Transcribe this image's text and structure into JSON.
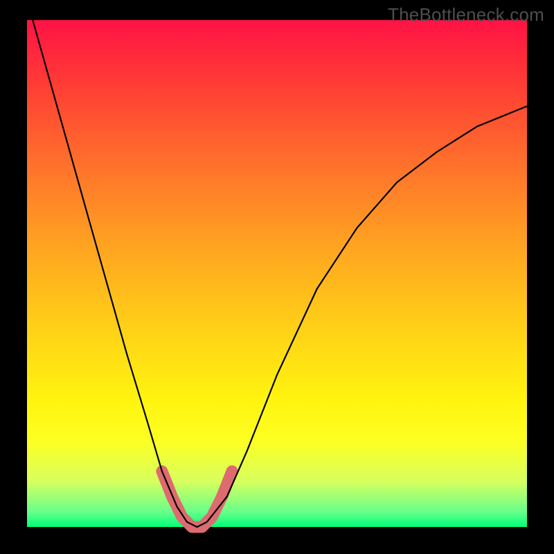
{
  "watermark": "TheBottleneck.com",
  "chart_data": {
    "type": "line",
    "title": "",
    "xlabel": "",
    "ylabel": "",
    "xlim": [
      0,
      100
    ],
    "ylim": [
      0,
      100
    ],
    "grid": false,
    "legend": false,
    "background_gradient": {
      "top": "#ff1245",
      "mid": "#ffd416",
      "bottom": "#00ff78"
    },
    "series": [
      {
        "name": "bottleneck-curve",
        "color": "#000000",
        "x": [
          0,
          4,
          8,
          12,
          16,
          20,
          24,
          27,
          30,
          32,
          34,
          36,
          40,
          44,
          50,
          58,
          66,
          74,
          82,
          90,
          100
        ],
        "y": [
          104,
          90,
          76,
          62,
          48,
          34,
          21,
          11,
          4,
          1,
          0,
          1,
          6,
          15,
          30,
          47,
          59,
          68,
          74,
          79,
          83
        ]
      },
      {
        "name": "optimal-zone-highlight",
        "color": "#dd6b6f",
        "x": [
          27,
          29,
          31,
          33,
          35,
          37,
          39,
          41
        ],
        "y": [
          11,
          6,
          2,
          0,
          0,
          2,
          6,
          11
        ]
      }
    ],
    "annotations": []
  }
}
